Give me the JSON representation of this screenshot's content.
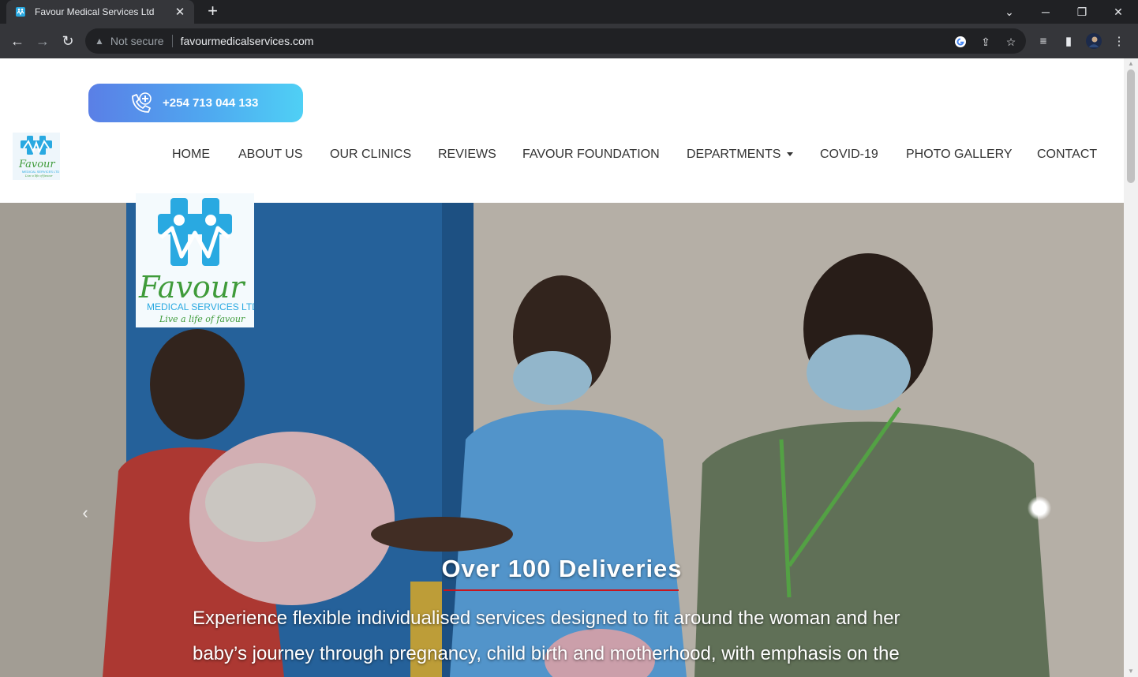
{
  "browser": {
    "tab": {
      "title": "Favour Medical Services Ltd",
      "close_glyph": "✕"
    },
    "newtab_glyph": "+",
    "window": {
      "chevron": "⌄",
      "minimize": "─",
      "restore": "❐",
      "close": "✕"
    },
    "nav": {
      "back": "←",
      "forward": "→",
      "reload": "↻"
    },
    "omnibox": {
      "security_label": "Not secure",
      "url": "favourmedicalservices.com",
      "warn_glyph": "▲"
    },
    "icons": {
      "share": "⇪",
      "star": "☆",
      "media": "≡",
      "sidepanel": "▮",
      "menu": "⋮"
    }
  },
  "site": {
    "phone": "+254 713 044 133",
    "nav_items": [
      {
        "label": "HOME"
      },
      {
        "label": "ABOUT US"
      },
      {
        "label": "OUR CLINICS"
      },
      {
        "label": "REVIEWS"
      },
      {
        "label": "FAVOUR FOUNDATION"
      },
      {
        "label": "DEPARTMENTS"
      },
      {
        "label": "COVID-19"
      },
      {
        "label": "PHOTO GALLERY"
      },
      {
        "label": "CONTACT"
      }
    ],
    "logo": {
      "wordmark": "Favour",
      "subtitle": "MEDICAL SERVICES LTD",
      "tagline": "Live a life of favour"
    },
    "slider": {
      "prev_glyph": "‹",
      "title": "Over 100 Deliveries",
      "text": "Experience flexible individualised services designed to fit around the woman and her baby’s journey through pregnancy, child birth and motherhood, with emphasis on the"
    }
  },
  "colors": {
    "brand_blue": "#29a9e1",
    "brand_green": "#3f9b3a",
    "caption_underline": "#c8151d",
    "phone_gradient_start": "#5a7fe6",
    "phone_gradient_end": "#4fd0f5"
  }
}
